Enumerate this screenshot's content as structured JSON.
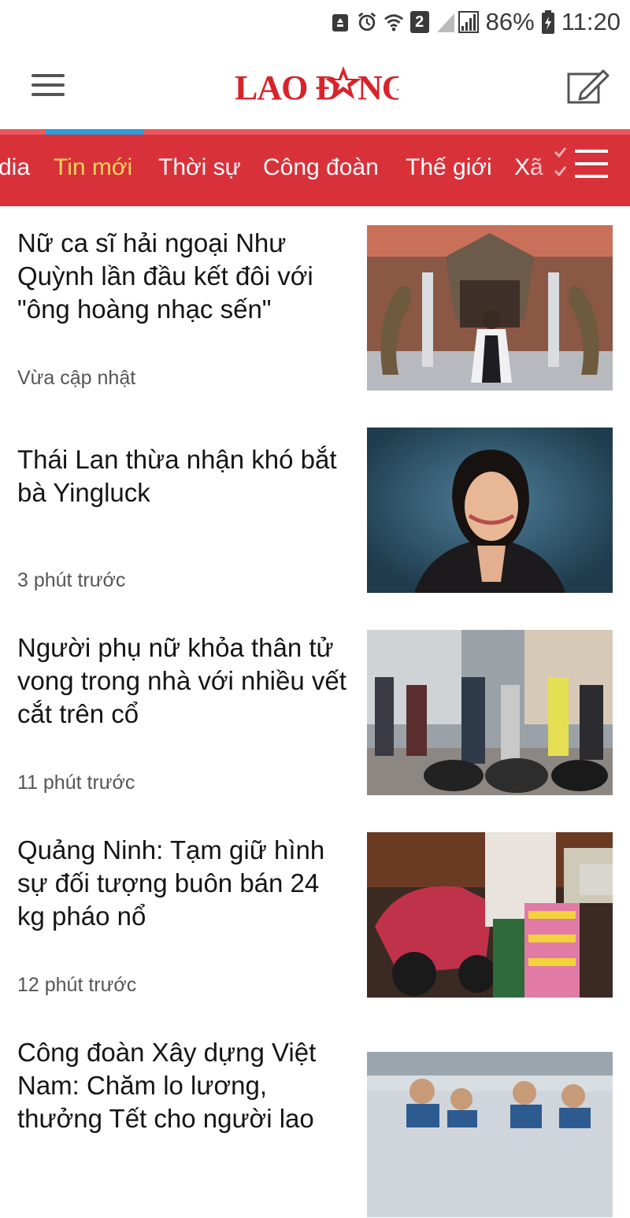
{
  "status_bar": {
    "battery": "86%",
    "time": "11:20",
    "sim_badge": "2"
  },
  "header": {
    "logo_text": "LAO ĐỘNG"
  },
  "tabs": [
    {
      "label": "dia"
    },
    {
      "label": "Tin mới",
      "active": true
    },
    {
      "label": "Thời sự"
    },
    {
      "label": "Công đoàn"
    },
    {
      "label": "Thế giới"
    },
    {
      "label": "Xã"
    }
  ],
  "articles": [
    {
      "title": "Nữ ca sĩ hải ngoại Như Quỳnh lần đầu kết đôi với \"ông hoàng nhạc sến\"",
      "time": "Vừa cập nhật"
    },
    {
      "title": "Thái Lan thừa nhận khó bắt bà Yingluck",
      "time": "3 phút trước"
    },
    {
      "title": "Người phụ nữ khỏa thân tử vong trong nhà với nhiều vết cắt trên cổ",
      "time": "11 phút trước"
    },
    {
      "title": "Quảng Ninh: Tạm giữ hình sự đối tượng buôn bán 24 kg pháo nổ",
      "time": "12 phút trước"
    },
    {
      "title": "Công đoàn Xây dựng Việt Nam: Chăm lo lương, thưởng Tết cho người lao",
      "time": ""
    }
  ],
  "colors": {
    "brand_red": "#d9313a",
    "active_tab": "#ffd45a",
    "indicator": "#2f9ad8"
  }
}
